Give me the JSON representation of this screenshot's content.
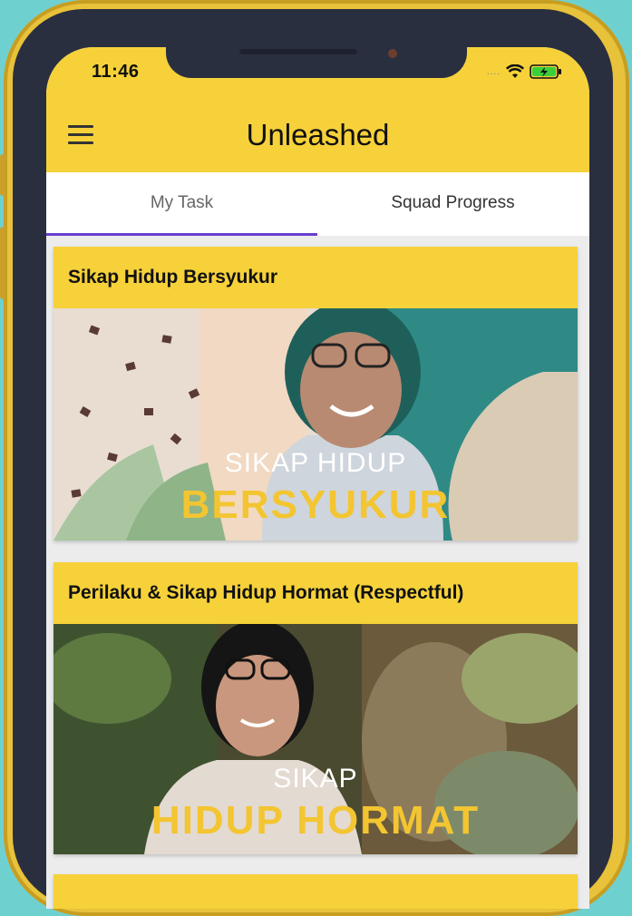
{
  "status": {
    "time": "11:46",
    "signal": "....",
    "wifi_icon": "wifi-icon",
    "battery_icon": "battery-charging-icon"
  },
  "appbar": {
    "title": "Unleashed",
    "menu_icon": "hamburger-menu-icon"
  },
  "tabs": [
    {
      "label": "My Task",
      "selected": true
    },
    {
      "label": "Squad Progress",
      "selected": false
    }
  ],
  "cards": [
    {
      "title": "Sikap Hidup Bersyukur",
      "thumb_line1": "SIKAP HIDUP",
      "thumb_line2": "BERSYUKUR"
    },
    {
      "title": "Perilaku & Sikap Hidup Hormat (Respectful)",
      "thumb_line1": "SIKAP",
      "thumb_line2": "HIDUP HORMAT"
    }
  ],
  "colors": {
    "accent": "#f6d13a",
    "tab_indicator": "#6a3fd0",
    "thumb_highlight": "#f3c531"
  }
}
